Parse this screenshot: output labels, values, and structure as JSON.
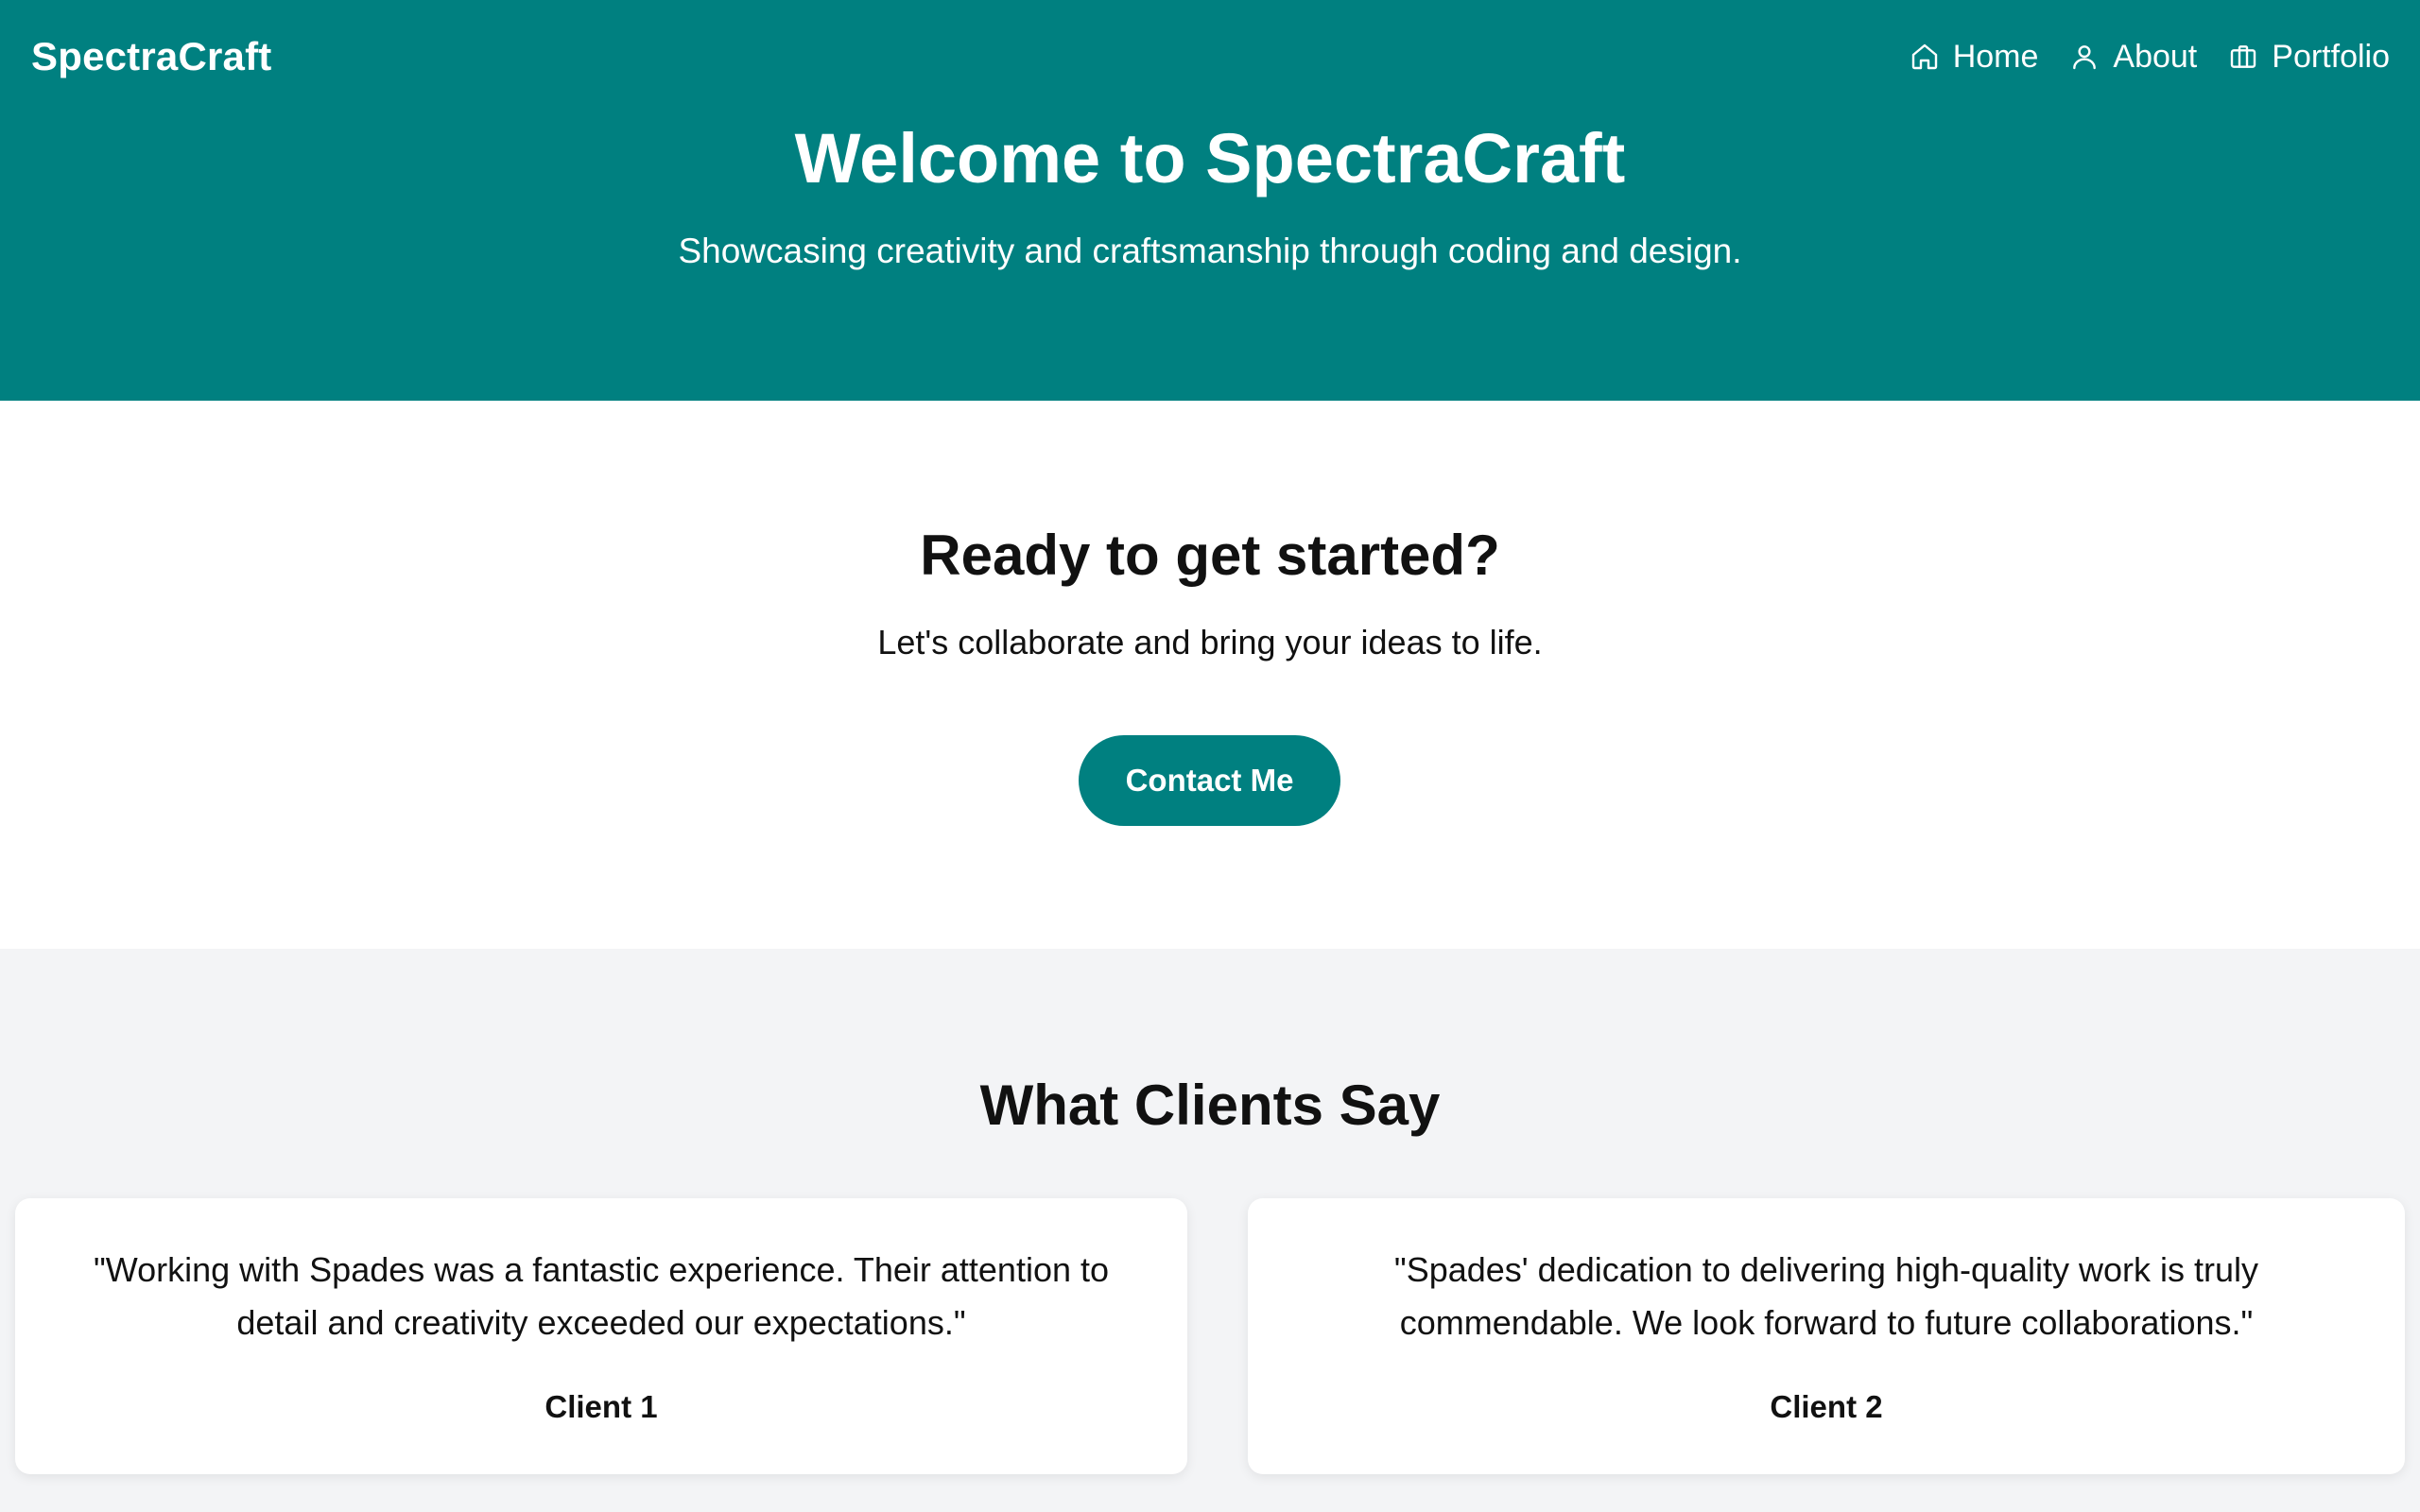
{
  "header": {
    "brand": "SpectraCraft",
    "nav": [
      {
        "label": "Home",
        "icon": "home-icon"
      },
      {
        "label": "About",
        "icon": "user-icon"
      },
      {
        "label": "Portfolio",
        "icon": "briefcase-icon"
      }
    ],
    "title": "Welcome to SpectraCraft",
    "subtitle": "Showcasing creativity and craftsmanship through coding and design."
  },
  "cta": {
    "title": "Ready to get started?",
    "subtitle": "Let's collaborate and bring your ideas to life.",
    "button_label": "Contact Me"
  },
  "testimonials": {
    "title": "What Clients Say",
    "items": [
      {
        "quote": "\"Working with Spades was a fantastic experience. Their attention to detail and creativity exceeded our expectations.\"",
        "client": "Client 1"
      },
      {
        "quote": "\"Spades' dedication to delivering high-quality work is truly commendable. We look forward to future collaborations.\"",
        "client": "Client 2"
      }
    ]
  },
  "colors": {
    "primary": "#008080",
    "background": "#f3f4f6",
    "card": "#ffffff",
    "text": "#111111"
  }
}
